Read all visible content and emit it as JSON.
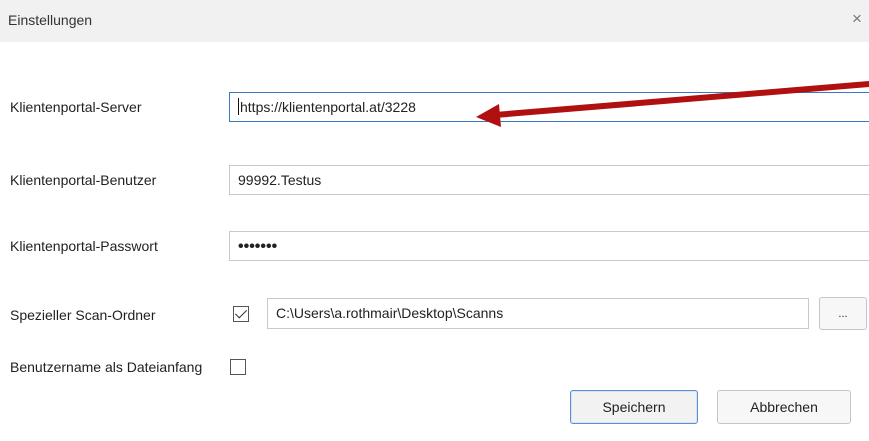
{
  "window": {
    "title": "Einstellungen",
    "close_glyph": "×"
  },
  "fields": {
    "server": {
      "label": "Klientenportal-Server",
      "value": "https://klientenportal.at/3228"
    },
    "user": {
      "label": "Klientenportal-Benutzer",
      "value": "99992.Testus"
    },
    "password": {
      "label": "Klientenportal-Passwort",
      "value": "•••••••"
    },
    "scan_folder": {
      "label": "Spezieller Scan-Ordner",
      "checked": true,
      "value": "C:\\Users\\a.rothmair\\Desktop\\Scanns",
      "browse_label": "..."
    },
    "filename_prefix": {
      "label": "Benutzername als Dateianfang",
      "checked": false
    }
  },
  "buttons": {
    "save": "Speichern",
    "cancel": "Abbrechen"
  },
  "annotation": {
    "type": "arrow",
    "color": "#b01010",
    "points_to": "server-input"
  }
}
